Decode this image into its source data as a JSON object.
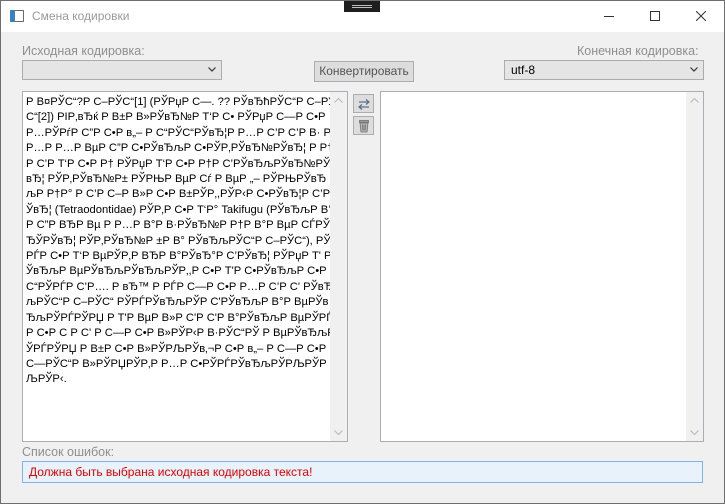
{
  "window": {
    "title": "Смена кодировки"
  },
  "source": {
    "label": "Исходная кодировка:",
    "selected": ""
  },
  "target": {
    "label": "Конечная кодировка:",
    "selected": "utf-8"
  },
  "convert_button": {
    "label": "Конвертировать"
  },
  "source_text": "Р В¤РЎС“?Р С–РЎС“[1] (РЎРџР С—. ?? РЎвЂћРЎС“Р С–РЎС“[2]) РІР‚вЂќ Р В±Р В»РЎвЂ№Р Т‘Р С• РЎРџР С—Р С•Р Р…РЎРѓР С”Р С•Р в„– Р С“РЎС“РЎвЂ¦Р Р…Р С’Р С’Р В· Р Р…Р Р…Р ВµР С”Р С•РЎвЂљР С•РЎР‚РЎвЂ№РЎвЂ¦ Р Р†Р С’Р Т‘Р С•Р Р† РЎРџР Т‘Р С•Р Р†Р С’РЎвЂљРЎвЂ№РЎвЂ¦ РЎР‚РЎвЂ№Р± РЎРЊР ВµР Сѓ Р ВµР „– РЎРЊРЎвЂљР Р†Р° Р С’Р С–Р В»Р С•Р В±РЎР‚,РЎР‹Р С•РЎвЂ¦Р С’РЎвЂ¦ (Tetraodontidae) РЎР‚Р С•Р Т‘Р° Takifugu (РЎвЂљР В°Р С”Р ВЂР Вµ Р Р…Р В°Р В·РЎвЂ№Р Р†Р В°Р ВµР СЃРЎвЂЎРЎвЂ¦ РЎР‚РЎвЂ№Р ±Р В° РЎвЂљРЎС“Р С–РЎС“), РЎРЃР С•Р Т‘Р ВµРЎР‚Р ВЂР В°РЎвЂ°Р С’РЎвЂ¦ РЎРџР Т' РЎвЂљР ВµРЎвЂљРЎвЂљРЎР‚,Р С•Р Т'Р С•РЎвЂљР С•Р С“РЎРЃР С’Р…. Р вЂ™ Р РЃР С—Р С•Р Р…Р С’Р С' РЎвЂљРЎС“Р С–РЎС“ РЎРЃРЎвЂљРЎР С'РЎвЂљР В°Р ВµРЎвЂљРЎРЃРЎРЏ Р Т'Р ВµР В»Р С'Р С'Р В°РЎвЂљР ВµРЎРЃР С•Р С Р С' Р С—Р С•Р В»РЎР‹Р В·РЎС“РЎ Р ВµРЎвЂљРЎРЃРЎРЏ Р В±Р С•Р В»РЎРЉРЎв‚¬Р С•Р в„– Р С—Р С•Р С—РЎС“Р В»РЎРЏРЎР‚Р Р…Р С•РЎРЃРЎвЂљРЎРЉРЎРЉРЎР‹.",
  "result_text": "",
  "errors": {
    "label": "Список ошибок:",
    "messages": [
      "Должна быть выбрана исходная кодировка текста!"
    ]
  }
}
